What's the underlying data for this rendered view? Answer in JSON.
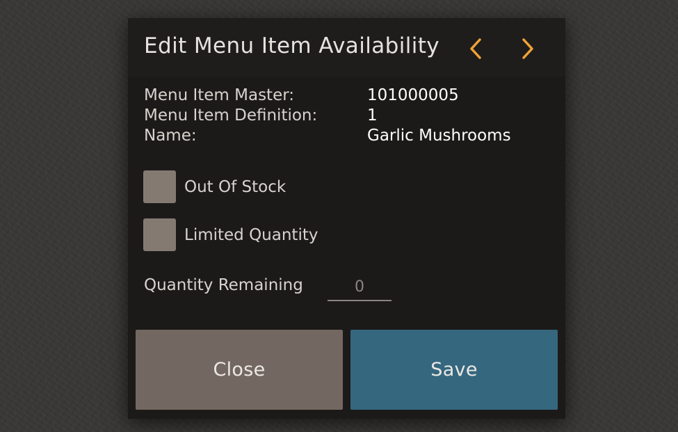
{
  "dialog": {
    "title": "Edit Menu Item Availability",
    "nav": {
      "prev_icon": "chevron-left-icon",
      "next_icon": "chevron-right-icon",
      "accent_color": "#f0a336"
    }
  },
  "info": {
    "master_label": "Menu Item Master:",
    "master_value": "101000005",
    "definition_label": "Menu Item Definition:",
    "definition_value": "1",
    "name_label": "Name:",
    "name_value": "Garlic Mushrooms"
  },
  "options": {
    "out_of_stock_label": "Out Of Stock",
    "out_of_stock_checked": false,
    "limited_quantity_label": "Limited Quantity",
    "limited_quantity_checked": false
  },
  "quantity": {
    "label": "Quantity Remaining",
    "value": "0"
  },
  "buttons": {
    "close_label": "Close",
    "save_label": "Save",
    "close_color": "#736861",
    "save_color": "#35677f"
  }
}
